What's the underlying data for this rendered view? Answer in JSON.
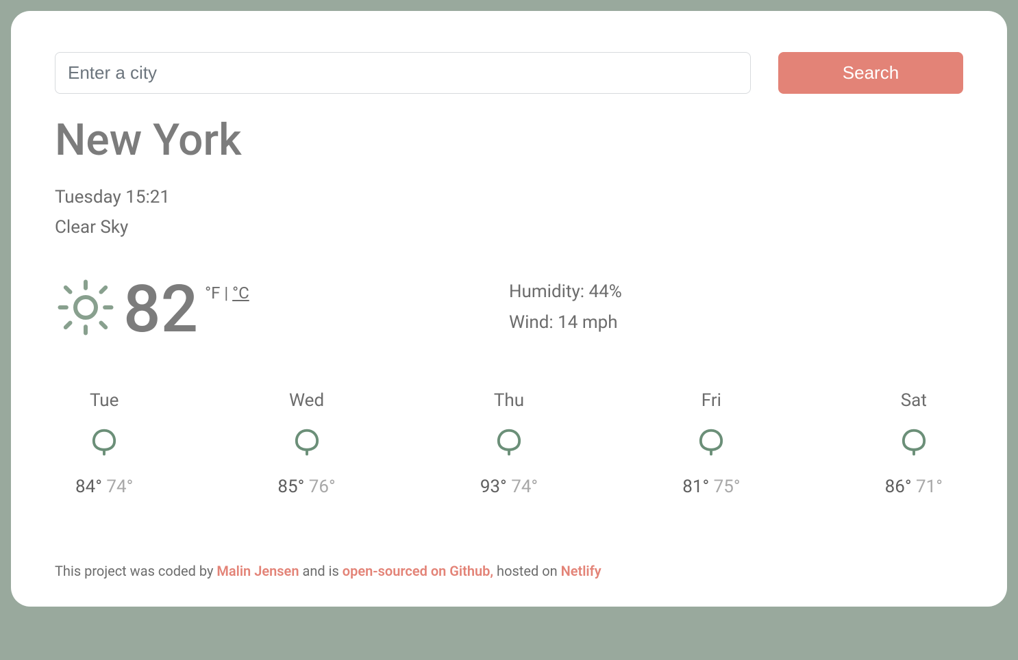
{
  "search": {
    "placeholder": "Enter a city",
    "button": "Search"
  },
  "city": "New York",
  "datetime": "Tuesday 15:21",
  "condition": "Clear Sky",
  "temperature": "82",
  "units": {
    "fahrenheit": "°F",
    "separator": " | ",
    "celsius": "°C"
  },
  "stats": {
    "humidity_label": "Humidity: ",
    "humidity_value": "44%",
    "wind_label": "Wind: ",
    "wind_value": "14 mph"
  },
  "forecast": [
    {
      "day": "Tue",
      "high": "84°",
      "low": "74°"
    },
    {
      "day": "Wed",
      "high": "85°",
      "low": "76°"
    },
    {
      "day": "Thu",
      "high": "93°",
      "low": "74°"
    },
    {
      "day": "Fri",
      "high": "81°",
      "low": "75°"
    },
    {
      "day": "Sat",
      "high": "86°",
      "low": "71°"
    }
  ],
  "footer": {
    "t1": "This project was coded by ",
    "author": "Malin Jensen",
    "t2": " and is ",
    "github": "open-sourced on Github,",
    "t3": " hosted on ",
    "netlify": "Netlify"
  }
}
